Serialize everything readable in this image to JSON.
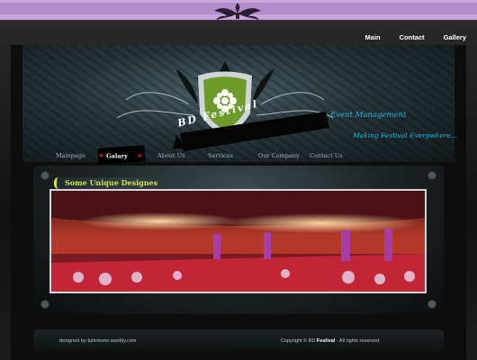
{
  "top_nav": {
    "main": "Main",
    "contact": "Contact",
    "gallery": "Gallery"
  },
  "brand": {
    "name": "BD Festival",
    "tagline_1": "Event Management",
    "tagline_2": "Making Festival Everywhere..."
  },
  "main_nav": [
    {
      "label": "Mainpage"
    },
    {
      "label": "Galary",
      "active": true
    },
    {
      "label": "About Us"
    },
    {
      "label": "Services"
    },
    {
      "label": "Our Company"
    },
    {
      "label": "Contact Us"
    }
  ],
  "section_title": "Some Unique Designes",
  "footer": {
    "designed_by": "designed by-tuhintsme.weebly.com",
    "copyright_prefix": "Copyright © BD",
    "copyright_brand": "Festival",
    "copyright_suffix": " - All rights reserved."
  },
  "colors": {
    "top_band": "#c9a6dd",
    "accent_green": "#d4e24a",
    "accent_blue": "#1fb7e0",
    "star_red": "#e0131f"
  },
  "icons": [
    "ornament-icon",
    "flower-icon",
    "star-icon"
  ]
}
